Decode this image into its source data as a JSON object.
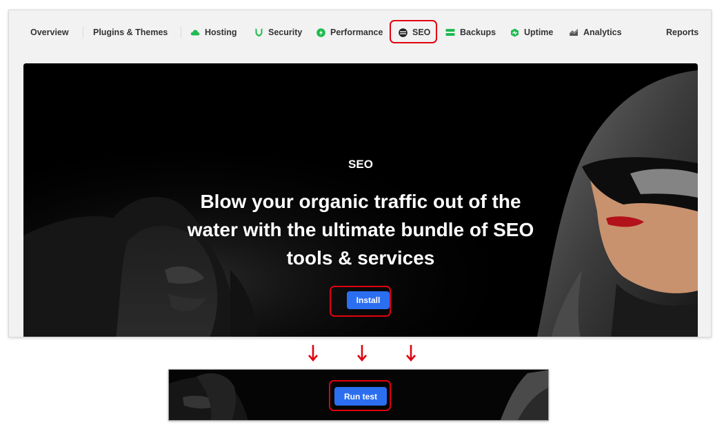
{
  "nav": {
    "overview": "Overview",
    "plugins_themes": "Plugins & Themes",
    "hosting": "Hosting",
    "security": "Security",
    "performance": "Performance",
    "seo": "SEO",
    "backups": "Backups",
    "uptime": "Uptime",
    "analytics": "Analytics",
    "reports": "Reports",
    "icons": {
      "hosting": "cloud-icon",
      "security": "shield-icon",
      "performance": "lightning-icon",
      "seo": "seo-globe-icon",
      "backups": "backups-icon",
      "uptime": "uptime-icon",
      "analytics": "analytics-icon"
    },
    "active": "SEO"
  },
  "hero": {
    "label": "SEO",
    "title": "Blow your organic traffic out of the water with the ultimate bundle of SEO tools & services",
    "install_button": "Install"
  },
  "strip": {
    "run_test_button": "Run test"
  },
  "colors": {
    "accent_green": "#1dbc4f",
    "button_blue": "#2b6ef0",
    "highlight_red": "#e3000f",
    "hero_bg": "#000000"
  }
}
